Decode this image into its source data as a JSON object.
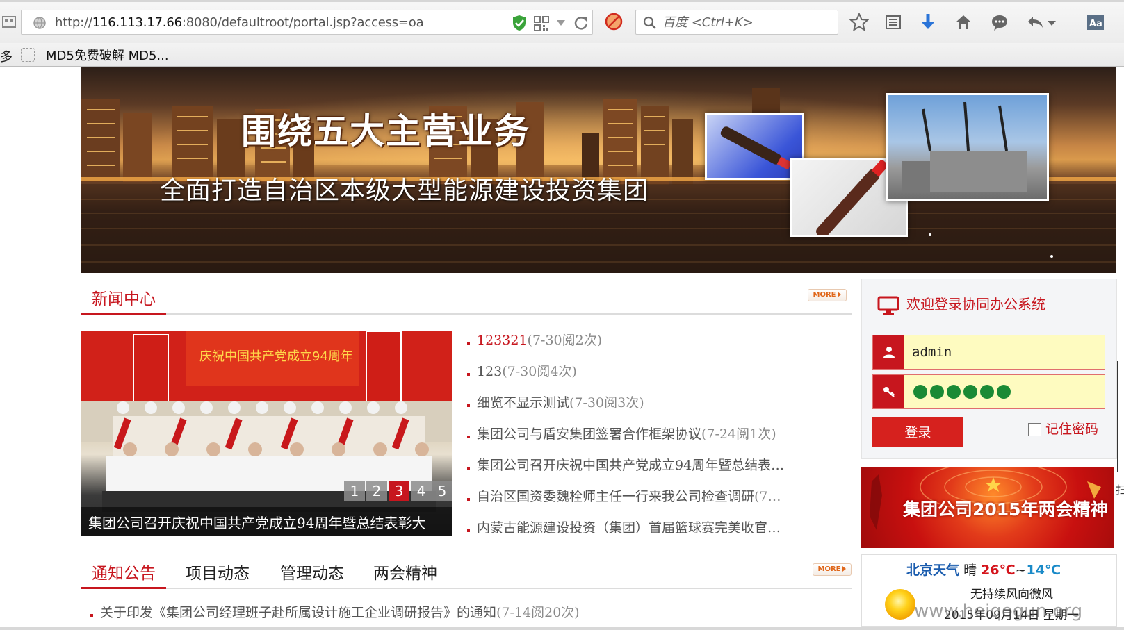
{
  "browser": {
    "url_prefix": "http://",
    "url_host": "116.113.17.66",
    "url_rest": ":8080/defaultroot/portal.jsp?access=oa",
    "search_placeholder": "百度 <Ctrl+K>",
    "bookmarks_partial": "多",
    "bookmark_label": "MD5免费破解 MD5..."
  },
  "banner": {
    "title": "围绕五大主营业务",
    "subtitle": "全面打造自治区本级大型能源建设投资集团"
  },
  "news": {
    "tab": "新闻中心",
    "more": "MORE",
    "slider_caption": "集团公司召开庆祝中国共产党成立94周年暨总结表彰大",
    "pages": [
      "1",
      "2",
      "3",
      "4",
      "5"
    ],
    "active_page": 3,
    "items": [
      {
        "title": "123321",
        "meta": "(7-30阅2次)"
      },
      {
        "title": "123",
        "meta": "(7-30阅4次)"
      },
      {
        "title": "细览不显示测试",
        "meta": "(7-30阅3次)"
      },
      {
        "title": "集团公司与盾安集团签署合作框架协议",
        "meta": "(7-24阅1次)"
      },
      {
        "title": "集团公司召开庆祝中国共产党成立94周年暨总结表…",
        "meta": ""
      },
      {
        "title": "自治区国资委魏栓师主任一行来我公司检查调研",
        "meta": "(7…"
      },
      {
        "title": "内蒙古能源建设投资（集团）首届篮球赛完美收官…",
        "meta": ""
      }
    ]
  },
  "login": {
    "title": "欢迎登录协同办公系统",
    "username": "admin",
    "password_dots": 6,
    "login_button": "登录",
    "remember_label": "记住密码"
  },
  "promo": {
    "text": "集团公司2015年两会精神"
  },
  "weather": {
    "city": "北京天气",
    "condition": "晴",
    "high": "26℃",
    "sep": "~",
    "low": "14℃",
    "wind": "无持续风向微风",
    "date": "2015年09月14日 星期一"
  },
  "notices": {
    "tabs": [
      "通知公告",
      "项目动态",
      "管理动态",
      "两会精神"
    ],
    "more": "MORE",
    "item": {
      "title": "关于印发《集团公司经理班子赴所属设计施工企业调研报告》的通知",
      "meta": "(7-14阅20次)"
    }
  },
  "watermark": "www.heiqogun.org",
  "edge_glyph": "扫"
}
